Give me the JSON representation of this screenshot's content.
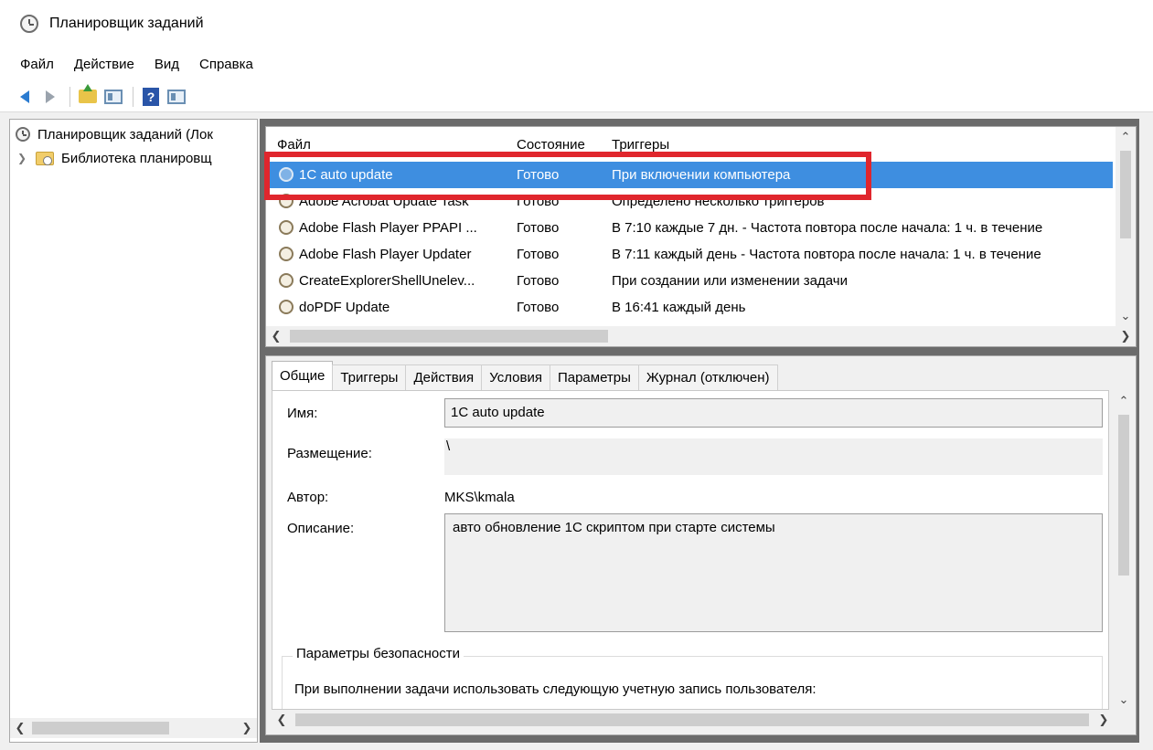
{
  "window": {
    "title": "Планировщик заданий",
    "icon": "clock-icon"
  },
  "menu": [
    "Файл",
    "Действие",
    "Вид",
    "Справка"
  ],
  "toolbar": {
    "buttons": [
      "back-arrow-icon",
      "forward-arrow-icon",
      "folder-up-icon",
      "show-hide-pane-icon",
      "help-icon",
      "action-pane-icon"
    ]
  },
  "tree": {
    "root": "Планировщик заданий (Лок",
    "library": "Библиотека планировщ"
  },
  "task_list": {
    "columns": [
      "Файл",
      "Состояние",
      "Триггеры"
    ],
    "rows": [
      {
        "name": "1C auto update",
        "state": "Готово",
        "trigger": "При включении компьютера",
        "selected": true
      },
      {
        "name": "Adobe Acrobat Update Task",
        "state": "Готово",
        "trigger": "Определено несколько триггеров",
        "selected": false
      },
      {
        "name": "Adobe Flash Player PPAPI ...",
        "state": "Готово",
        "trigger": "В 7:10 каждые 7 дн. - Частота повтора после начала: 1 ч. в течение",
        "selected": false
      },
      {
        "name": "Adobe Flash Player Updater",
        "state": "Готово",
        "trigger": "В 7:11 каждый день - Частота повтора после начала: 1 ч. в течение",
        "selected": false
      },
      {
        "name": "CreateExplorerShellUnelev...",
        "state": "Готово",
        "trigger": "При создании или изменении задачи",
        "selected": false
      },
      {
        "name": "doPDF Update",
        "state": "Готово",
        "trigger": "В 16:41 каждый день",
        "selected": false
      }
    ]
  },
  "detail": {
    "tabs": [
      "Общие",
      "Триггеры",
      "Действия",
      "Условия",
      "Параметры",
      "Журнал (отключен)"
    ],
    "active_tab": "Общие",
    "labels": {
      "name": "Имя:",
      "location": "Размещение:",
      "author": "Автор:",
      "description": "Описание:"
    },
    "values": {
      "name": "1C auto update",
      "location": "\\",
      "author": "MKS\\kmala",
      "description": "авто обновление 1С скриптом при старте системы"
    },
    "security": {
      "title": "Параметры безопасности",
      "text": "При выполнении задачи использовать следующую учетную запись пользователя:"
    }
  },
  "colors": {
    "selection": "#3e8ee0",
    "highlight_box": "#e0262d",
    "frame": "#6b6b6b"
  }
}
